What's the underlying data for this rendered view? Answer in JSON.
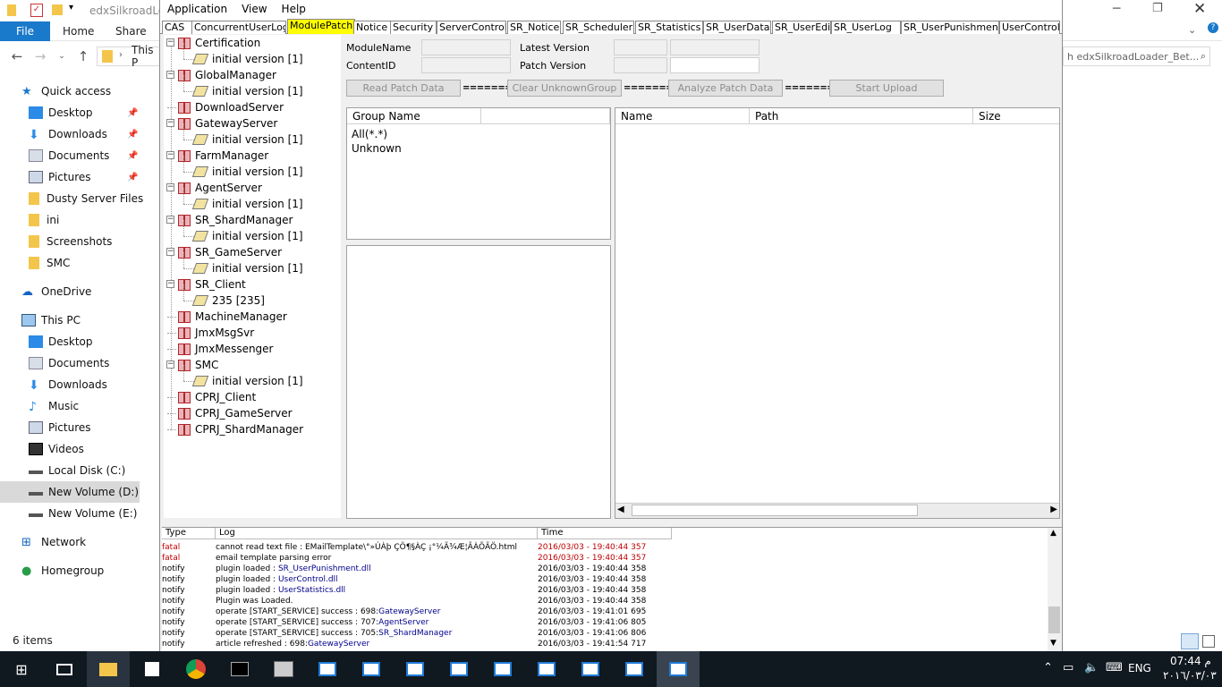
{
  "explorer": {
    "title": "edxSilkroadLoa",
    "ribbon_tabs": [
      "File",
      "Home",
      "Share"
    ],
    "address_text": "This P",
    "search_text": "h edxSilkroadLoader_Bet...",
    "nav": {
      "quick_access": "Quick access",
      "quick_items": [
        "Desktop",
        "Downloads",
        "Documents",
        "Pictures",
        "Dusty Server Files",
        "ini",
        "Screenshots",
        "SMC"
      ],
      "onedrive": "OneDrive",
      "this_pc": "This PC",
      "pc_items": [
        "Desktop",
        "Documents",
        "Downloads",
        "Music",
        "Pictures",
        "Videos",
        "Local Disk (C:)",
        "New Volume (D:)",
        "New Volume (E:)"
      ],
      "network": "Network",
      "homegroup": "Homegroup"
    },
    "status": "6 items"
  },
  "app": {
    "menu": [
      "Application",
      "View",
      "Help"
    ],
    "tabs": [
      "CAS",
      "ConcurrentUserLog",
      "ModulePatch",
      "Notice",
      "Security",
      "ServerControl",
      "SR_Notice",
      "SR_Scheduler",
      "SR_Statistics",
      "SR_UserData",
      "SR_UserEdit",
      "SR_UserLog",
      "SR_UserPunishment",
      "UserControl"
    ],
    "active_tab": "ModulePatch",
    "tree": [
      {
        "name": "Certification",
        "child": "initial version [1]"
      },
      {
        "name": "GlobalManager",
        "child": "initial version [1]"
      },
      {
        "name": "DownloadServer",
        "child": null
      },
      {
        "name": "GatewayServer",
        "child": "initial version [1]"
      },
      {
        "name": "FarmManager",
        "child": "initial version [1]"
      },
      {
        "name": "AgentServer",
        "child": "initial version [1]"
      },
      {
        "name": "SR_ShardManager",
        "child": "initial version [1]"
      },
      {
        "name": "SR_GameServer",
        "child": "initial version [1]"
      },
      {
        "name": "SR_Client",
        "child": "235 [235]"
      },
      {
        "name": "MachineManager",
        "child": null
      },
      {
        "name": "JmxMsgSvr",
        "child": null
      },
      {
        "name": "JmxMessenger",
        "child": null
      },
      {
        "name": "SMC",
        "child": "initial version [1]"
      },
      {
        "name": "CPRJ_Client",
        "child": null
      },
      {
        "name": "CPRJ_GameServer",
        "child": null
      },
      {
        "name": "CPRJ_ShardManager",
        "child": null
      }
    ],
    "fields": {
      "module_name_label": "ModuleName",
      "content_id_label": "ContentID",
      "latest_version_label": "Latest Version",
      "patch_version_label": "Patch Version"
    },
    "buttons": {
      "read_patch": "Read Patch Data",
      "clear_unknown": "Clear UnknownGroup",
      "analyze_patch": "Analyze Patch Data",
      "start_upload": "Start Upload",
      "arrow": "=======>"
    },
    "group_list": {
      "header": "Group Name",
      "items": [
        "All(*.*)",
        "Unknown"
      ]
    },
    "file_list": {
      "headers": [
        "Name",
        "Path",
        "Size"
      ]
    },
    "log": {
      "headers": [
        "Type",
        "Log",
        "Time"
      ],
      "rows": [
        {
          "type": "fatal",
          "pre": "cannot read text file : EMailTemplate\\°»ÚÀþ ÇÖ¶§ÀÇ ¡°¼Ã¾Æ¦ÃÀÕÃÖ.html",
          "link": "",
          "time": "2016/03/03 - 19:40:44 357"
        },
        {
          "type": "fatal",
          "pre": "email template parsing error",
          "link": "",
          "time": "2016/03/03 - 19:40:44 357"
        },
        {
          "type": "notify",
          "pre": "plugin loaded : ",
          "link": "SR_UserPunishment.dll",
          "time": "2016/03/03 - 19:40:44 358"
        },
        {
          "type": "notify",
          "pre": "plugin loaded : ",
          "link": "UserControl.dll",
          "time": "2016/03/03 - 19:40:44 358"
        },
        {
          "type": "notify",
          "pre": "plugin loaded : ",
          "link": "UserStatistics.dll",
          "time": "2016/03/03 - 19:40:44 358"
        },
        {
          "type": "notify",
          "pre": "Plugin was Loaded.",
          "link": "",
          "time": "2016/03/03 - 19:40:44 358"
        },
        {
          "type": "notify",
          "pre": "operate [START_SERVICE] success : 698:",
          "link": "GatewayServer",
          "time": "2016/03/03 - 19:41:01 695"
        },
        {
          "type": "notify",
          "pre": "operate [START_SERVICE] success : 707:",
          "link": "AgentServer",
          "time": "2016/03/03 - 19:41:06 805"
        },
        {
          "type": "notify",
          "pre": "operate [START_SERVICE] success : 705:",
          "link": "SR_ShardManager",
          "time": "2016/03/03 - 19:41:06 806"
        },
        {
          "type": "notify",
          "pre": "article refreshed : 698:",
          "link": "GatewayServer",
          "time": "2016/03/03 - 19:41:54 717"
        }
      ]
    }
  },
  "taskbar": {
    "lang": "ENG",
    "time": "07:44 م",
    "date": "٢٠١٦/٠٣/٠٣"
  },
  "colors": {
    "active_tab": "#ffff00",
    "fatal": "#c00000",
    "link": "#00008b",
    "taskbar": "#101820"
  }
}
